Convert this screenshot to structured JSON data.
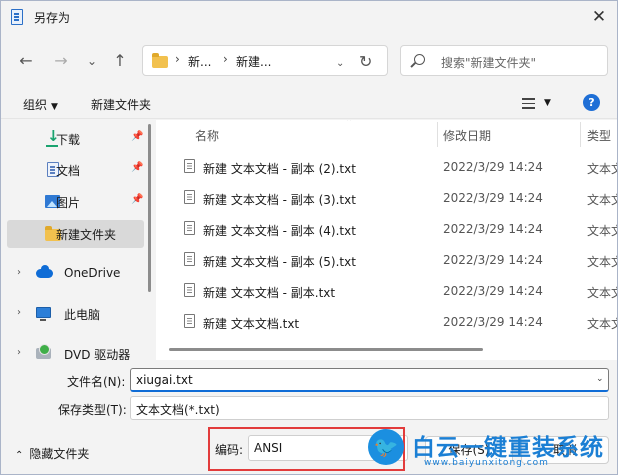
{
  "window": {
    "title": "另存为",
    "close_glyph": "✕"
  },
  "nav": {
    "back": "←",
    "forward": "→",
    "recent": "⌄",
    "up": "↑",
    "breadcrumb": [
      "新...",
      "新建..."
    ],
    "separator": "›",
    "address_chevron": "⌄",
    "refresh": "↻",
    "search_placeholder": "搜索\"新建文件夹\""
  },
  "toolbar": {
    "organize": "组织",
    "new_folder": "新建文件夹",
    "help": "?"
  },
  "sidebar": {
    "items": [
      {
        "label": "下载",
        "icon": "download-icon",
        "pinned": true
      },
      {
        "label": "文档",
        "icon": "document-icon",
        "pinned": true
      },
      {
        "label": "图片",
        "icon": "pictures-icon",
        "pinned": true
      },
      {
        "label": "新建文件夹",
        "icon": "folder-icon",
        "selected": true
      },
      {
        "label": "OneDrive",
        "icon": "cloud-icon",
        "expandable": true
      },
      {
        "label": "此电脑",
        "icon": "computer-icon",
        "expandable": true
      },
      {
        "label": "DVD 驱动器 (D:)",
        "icon": "dvd-icon",
        "expandable": true
      }
    ]
  },
  "columns": {
    "name": "名称",
    "date": "修改日期",
    "type": "类型"
  },
  "files": [
    {
      "name": "新建 文本文档 - 副本 (2).txt",
      "date": "2022/3/29 14:24",
      "type": "文本文"
    },
    {
      "name": "新建 文本文档 - 副本 (3).txt",
      "date": "2022/3/29 14:24",
      "type": "文本文"
    },
    {
      "name": "新建 文本文档 - 副本 (4).txt",
      "date": "2022/3/29 14:24",
      "type": "文本文"
    },
    {
      "name": "新建 文本文档 - 副本 (5).txt",
      "date": "2022/3/29 14:24",
      "type": "文本文"
    },
    {
      "name": "新建 文本文档 - 副本.txt",
      "date": "2022/3/29 14:24",
      "type": "文本文"
    },
    {
      "name": "新建 文本文档.txt",
      "date": "2022/3/29 14:24",
      "type": "文本文"
    }
  ],
  "form": {
    "filename_label": "文件名(N):",
    "filename_value": "xiugai.txt",
    "savetype_label": "保存类型(T):",
    "savetype_value": "文本文档(*.txt)",
    "hide_folders": "隐藏文件夹",
    "encoding_label": "编码:",
    "encoding_value": "ANSI",
    "save_button": "保存(S)",
    "cancel_button": "取消"
  },
  "watermark": {
    "text": "白云一键重装系统",
    "url": "www.baiyunxitong.com"
  },
  "colors": {
    "accent": "#0f6cd6",
    "highlight_box": "#e23b3b",
    "selected": "#d9d9d9"
  }
}
